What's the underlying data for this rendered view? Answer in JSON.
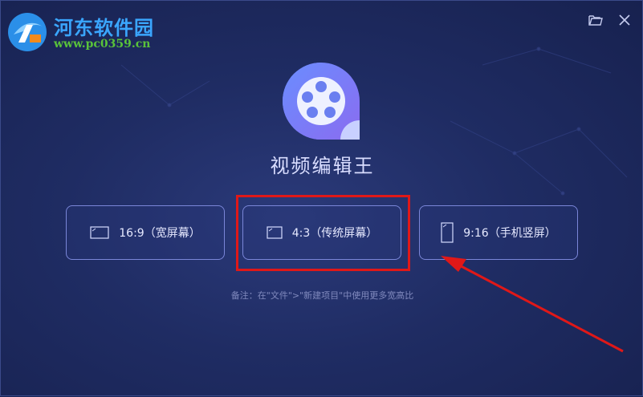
{
  "watermark": {
    "title": "河东软件园",
    "url": "www.pc0359.cn"
  },
  "topbar": {
    "icons": [
      "folder-icon",
      "close-icon"
    ]
  },
  "app": {
    "name": "视频编辑王"
  },
  "ratios": [
    {
      "label": "16:9（宽屏幕）",
      "icon": "landscape-screen-icon"
    },
    {
      "label": "4:3（传统屏幕）",
      "icon": "landscape-screen-icon"
    },
    {
      "label": "9:16（手机竖屏）",
      "icon": "portrait-screen-icon"
    }
  ],
  "note": "备注：在\"文件\">\"新建项目\"中使用更多宽高比",
  "annotation": {
    "highlight_color": "#e01818"
  }
}
